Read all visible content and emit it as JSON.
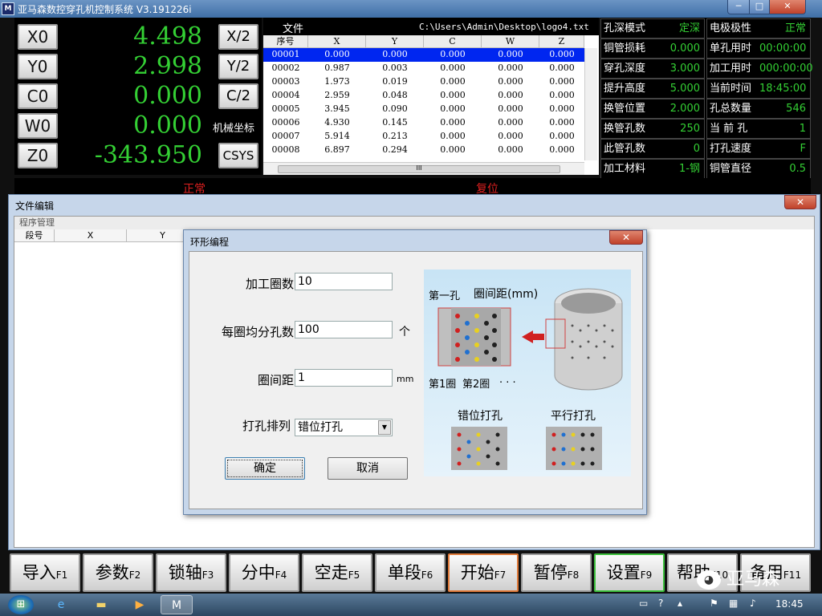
{
  "window": {
    "title": "亚马森数控穿孔机控制系统 V3.191226i",
    "icon": "M",
    "min": "─",
    "max": "□",
    "close": "✕"
  },
  "coords": [
    {
      "axis": "X0",
      "value": "4.498",
      "side": "X/2"
    },
    {
      "axis": "Y0",
      "value": "2.998",
      "side": "Y/2"
    },
    {
      "axis": "C0",
      "value": "0.000",
      "side": "C/2"
    },
    {
      "axis": "W0",
      "value": "0.000",
      "side": "机械坐标"
    },
    {
      "axis": "Z0",
      "value": "-343.950",
      "side": "CSYS"
    }
  ],
  "file": {
    "label": "文件",
    "path": "C:\\Users\\Admin\\Desktop\\logo4.txt",
    "columns": [
      "序号",
      "X",
      "Y",
      "C",
      "W",
      "Z"
    ],
    "rows": [
      [
        "00001",
        "0.000",
        "0.000",
        "0.000",
        "0.000",
        "0.000"
      ],
      [
        "00002",
        "0.987",
        "0.003",
        "0.000",
        "0.000",
        "0.000"
      ],
      [
        "00003",
        "1.973",
        "0.019",
        "0.000",
        "0.000",
        "0.000"
      ],
      [
        "00004",
        "2.959",
        "0.048",
        "0.000",
        "0.000",
        "0.000"
      ],
      [
        "00005",
        "3.945",
        "0.090",
        "0.000",
        "0.000",
        "0.000"
      ],
      [
        "00006",
        "4.930",
        "0.145",
        "0.000",
        "0.000",
        "0.000"
      ],
      [
        "00007",
        "5.914",
        "0.213",
        "0.000",
        "0.000",
        "0.000"
      ],
      [
        "00008",
        "6.897",
        "0.294",
        "0.000",
        "0.000",
        "0.000"
      ]
    ],
    "scroll_grip": "III"
  },
  "params": [
    [
      "孔深模式",
      "定深",
      "电极极性",
      "正常"
    ],
    [
      "铜管损耗",
      "0.000",
      "单孔用时",
      "00:00:00"
    ],
    [
      "穿孔深度",
      "3.000",
      "加工用时",
      "000:00:00"
    ],
    [
      "提升高度",
      "5.000",
      "当前时间",
      "18:45:00"
    ],
    [
      "换管位置",
      "2.000",
      "孔总数量",
      "546"
    ],
    [
      "换管孔数",
      "250",
      "当 前 孔",
      "1"
    ],
    [
      "此管孔数",
      "0",
      "打孔速度",
      "F"
    ],
    [
      "加工材料",
      "1-钢",
      "铜管直径",
      "0.5"
    ]
  ],
  "status": {
    "left": "正常",
    "right": "复位"
  },
  "file_edit": {
    "title": "文件编辑",
    "tab": "程序管理",
    "columns": [
      "段号",
      "X",
      "Y"
    ],
    "close": "✕"
  },
  "dialog": {
    "title": "环形编程",
    "close": "✕",
    "fields": [
      {
        "label": "加工圈数",
        "value": "10",
        "unit": ""
      },
      {
        "label": "每圈均分孔数",
        "value": "100",
        "unit": "个"
      },
      {
        "label": "圈间距",
        "value": "1",
        "unit": "mm"
      }
    ],
    "arrange_label": "打孔排列",
    "arrange_value": "错位打孔",
    "ok": "确定",
    "cancel": "取消",
    "illustration": {
      "first_hole": "第一孔",
      "ring_spacing": "圈间距(mm)",
      "ring1": "第1圈",
      "ring2": "第2圈",
      "dots": ". . .",
      "staggered": "错位打孔",
      "parallel": "平行打孔"
    }
  },
  "fkeys": [
    {
      "label": "导入",
      "key": "F1"
    },
    {
      "label": "参数",
      "key": "F2"
    },
    {
      "label": "锁轴",
      "key": "F3"
    },
    {
      "label": "分中",
      "key": "F4"
    },
    {
      "label": "空走",
      "key": "F5"
    },
    {
      "label": "单段",
      "key": "F6"
    },
    {
      "label": "开始",
      "key": "F7"
    },
    {
      "label": "暂停",
      "key": "F8"
    },
    {
      "label": "设置",
      "key": "F9"
    },
    {
      "label": "帮助",
      "key": "F10"
    },
    {
      "label": "备用",
      "key": "F11"
    }
  ],
  "watermark": "亚马森",
  "taskbar": {
    "time": "18:45"
  }
}
